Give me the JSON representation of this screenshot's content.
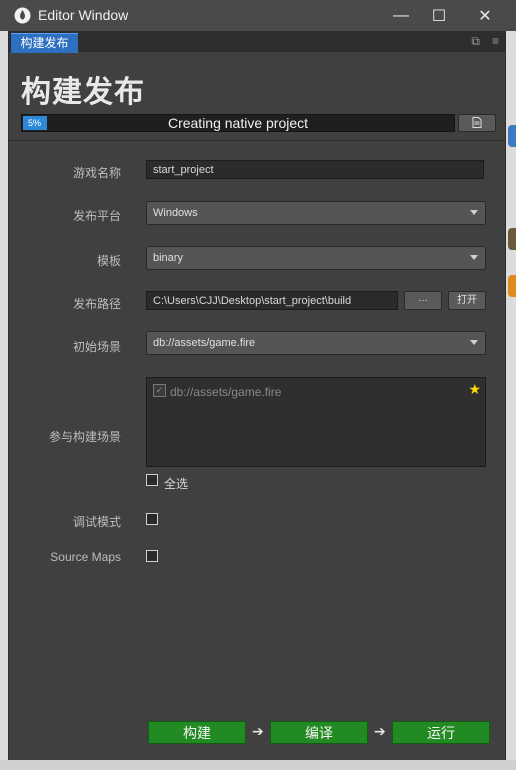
{
  "window": {
    "title": "Editor Window",
    "controls": {
      "minimize": "—",
      "maximize": "☐",
      "close": "✕"
    }
  },
  "tab": {
    "label": "构建发布"
  },
  "panel": {
    "title": "构建发布",
    "progress": {
      "percent_label": "5%",
      "fraction": 0.05,
      "status": "Creating native project"
    }
  },
  "form": {
    "game_name": {
      "label": "游戏名称",
      "value": "start_project"
    },
    "platform": {
      "label": "发布平台",
      "value": "Windows"
    },
    "template": {
      "label": "模板",
      "value": "binary"
    },
    "build_path": {
      "label": "发布路径",
      "value": "C:\\Users\\CJJ\\Desktop\\start_project\\build",
      "browse_label": "···",
      "open_label": "打开"
    },
    "start_scene": {
      "label": "初始场景",
      "value": "db://assets/game.fire"
    },
    "included_scenes": {
      "label": "参与构建场景",
      "items": [
        "db://assets/game.fire"
      ],
      "select_all_label": "全选"
    },
    "debug": {
      "label": "调试模式"
    },
    "source_maps": {
      "label": "Source Maps"
    }
  },
  "actions": {
    "build": "构建",
    "compile": "编译",
    "run": "运行"
  },
  "colors": {
    "accent": "#2d88d8",
    "action_green": "#228a22",
    "star": "#ffd800"
  }
}
